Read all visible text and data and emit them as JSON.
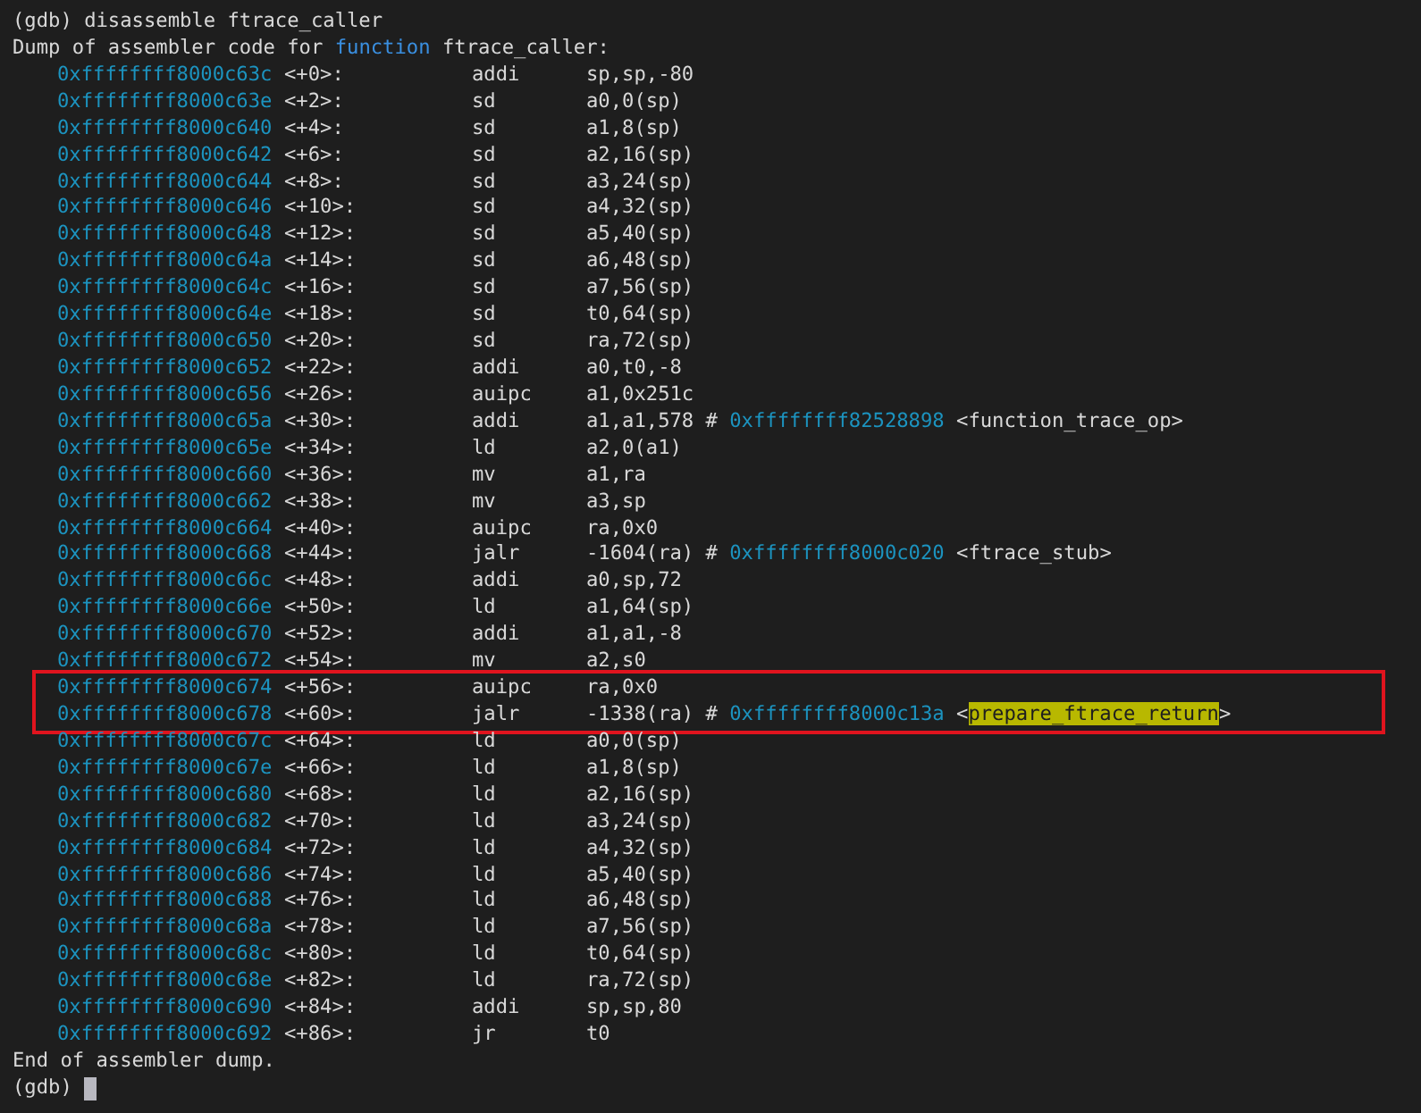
{
  "terminal": {
    "command_line": {
      "prompt": "(gdb)",
      "command": "disassemble ftrace_caller"
    },
    "header": [
      {
        "text": "Dump of assembler code for ",
        "kind": "plain"
      },
      {
        "text": "function",
        "kind": "keyword"
      },
      {
        "text": " ftrace_caller:",
        "kind": "plain"
      }
    ],
    "rows": [
      {
        "address": "0xffffffff8000c63c",
        "offset": "<+0>:",
        "mnemonic": "addi",
        "operands": "sp,sp,-80",
        "boxed": false
      },
      {
        "address": "0xffffffff8000c63e",
        "offset": "<+2>:",
        "mnemonic": "sd",
        "operands": "a0,0(sp)",
        "boxed": false
      },
      {
        "address": "0xffffffff8000c640",
        "offset": "<+4>:",
        "mnemonic": "sd",
        "operands": "a1,8(sp)",
        "boxed": false
      },
      {
        "address": "0xffffffff8000c642",
        "offset": "<+6>:",
        "mnemonic": "sd",
        "operands": "a2,16(sp)",
        "boxed": false
      },
      {
        "address": "0xffffffff8000c644",
        "offset": "<+8>:",
        "mnemonic": "sd",
        "operands": "a3,24(sp)",
        "boxed": false
      },
      {
        "address": "0xffffffff8000c646",
        "offset": "<+10>:",
        "mnemonic": "sd",
        "operands": "a4,32(sp)",
        "boxed": false
      },
      {
        "address": "0xffffffff8000c648",
        "offset": "<+12>:",
        "mnemonic": "sd",
        "operands": "a5,40(sp)",
        "boxed": false
      },
      {
        "address": "0xffffffff8000c64a",
        "offset": "<+14>:",
        "mnemonic": "sd",
        "operands": "a6,48(sp)",
        "boxed": false
      },
      {
        "address": "0xffffffff8000c64c",
        "offset": "<+16>:",
        "mnemonic": "sd",
        "operands": "a7,56(sp)",
        "boxed": false
      },
      {
        "address": "0xffffffff8000c64e",
        "offset": "<+18>:",
        "mnemonic": "sd",
        "operands": "t0,64(sp)",
        "boxed": false
      },
      {
        "address": "0xffffffff8000c650",
        "offset": "<+20>:",
        "mnemonic": "sd",
        "operands": "ra,72(sp)",
        "boxed": false
      },
      {
        "address": "0xffffffff8000c652",
        "offset": "<+22>:",
        "mnemonic": "addi",
        "operands": "a0,t0,-8",
        "boxed": false
      },
      {
        "address": "0xffffffff8000c656",
        "offset": "<+26>:",
        "mnemonic": "auipc",
        "operands": "a1,0x251c",
        "boxed": false
      },
      {
        "address": "0xffffffff8000c65a",
        "offset": "<+30>:",
        "mnemonic": "addi",
        "operands": "a1,a1,578",
        "boxed": false,
        "comment": {
          "hash": "#",
          "target": "0xffffffff82528898",
          "open": "<",
          "symbol": "function_trace_op",
          "close": ">",
          "highlighted": false
        }
      },
      {
        "address": "0xffffffff8000c65e",
        "offset": "<+34>:",
        "mnemonic": "ld",
        "operands": "a2,0(a1)",
        "boxed": false
      },
      {
        "address": "0xffffffff8000c660",
        "offset": "<+36>:",
        "mnemonic": "mv",
        "operands": "a1,ra",
        "boxed": false
      },
      {
        "address": "0xffffffff8000c662",
        "offset": "<+38>:",
        "mnemonic": "mv",
        "operands": "a3,sp",
        "boxed": false
      },
      {
        "address": "0xffffffff8000c664",
        "offset": "<+40>:",
        "mnemonic": "auipc",
        "operands": "ra,0x0",
        "boxed": false
      },
      {
        "address": "0xffffffff8000c668",
        "offset": "<+44>:",
        "mnemonic": "jalr",
        "operands": "-1604(ra)",
        "boxed": false,
        "comment": {
          "hash": "#",
          "target": "0xffffffff8000c020",
          "open": "<",
          "symbol": "ftrace_stub",
          "close": ">",
          "highlighted": false
        }
      },
      {
        "address": "0xffffffff8000c66c",
        "offset": "<+48>:",
        "mnemonic": "addi",
        "operands": "a0,sp,72",
        "boxed": false
      },
      {
        "address": "0xffffffff8000c66e",
        "offset": "<+50>:",
        "mnemonic": "ld",
        "operands": "a1,64(sp)",
        "boxed": false
      },
      {
        "address": "0xffffffff8000c670",
        "offset": "<+52>:",
        "mnemonic": "addi",
        "operands": "a1,a1,-8",
        "boxed": false
      },
      {
        "address": "0xffffffff8000c672",
        "offset": "<+54>:",
        "mnemonic": "mv",
        "operands": "a2,s0",
        "boxed": false
      },
      {
        "address": "0xffffffff8000c674",
        "offset": "<+56>:",
        "mnemonic": "auipc",
        "operands": "ra,0x0",
        "boxed": true
      },
      {
        "address": "0xffffffff8000c678",
        "offset": "<+60>:",
        "mnemonic": "jalr",
        "operands": "-1338(ra)",
        "boxed": true,
        "comment": {
          "hash": "#",
          "target": "0xffffffff8000c13a",
          "open": "<",
          "symbol": "prepare_ftrace_return",
          "close": ">",
          "highlighted": true
        }
      },
      {
        "address": "0xffffffff8000c67c",
        "offset": "<+64>:",
        "mnemonic": "ld",
        "operands": "a0,0(sp)",
        "boxed": false
      },
      {
        "address": "0xffffffff8000c67e",
        "offset": "<+66>:",
        "mnemonic": "ld",
        "operands": "a1,8(sp)",
        "boxed": false
      },
      {
        "address": "0xffffffff8000c680",
        "offset": "<+68>:",
        "mnemonic": "ld",
        "operands": "a2,16(sp)",
        "boxed": false
      },
      {
        "address": "0xffffffff8000c682",
        "offset": "<+70>:",
        "mnemonic": "ld",
        "operands": "a3,24(sp)",
        "boxed": false
      },
      {
        "address": "0xffffffff8000c684",
        "offset": "<+72>:",
        "mnemonic": "ld",
        "operands": "a4,32(sp)",
        "boxed": false
      },
      {
        "address": "0xffffffff8000c686",
        "offset": "<+74>:",
        "mnemonic": "ld",
        "operands": "a5,40(sp)",
        "boxed": false
      },
      {
        "address": "0xffffffff8000c688",
        "offset": "<+76>:",
        "mnemonic": "ld",
        "operands": "a6,48(sp)",
        "boxed": false
      },
      {
        "address": "0xffffffff8000c68a",
        "offset": "<+78>:",
        "mnemonic": "ld",
        "operands": "a7,56(sp)",
        "boxed": false
      },
      {
        "address": "0xffffffff8000c68c",
        "offset": "<+80>:",
        "mnemonic": "ld",
        "operands": "t0,64(sp)",
        "boxed": false
      },
      {
        "address": "0xffffffff8000c68e",
        "offset": "<+82>:",
        "mnemonic": "ld",
        "operands": "ra,72(sp)",
        "boxed": false
      },
      {
        "address": "0xffffffff8000c690",
        "offset": "<+84>:",
        "mnemonic": "addi",
        "operands": "sp,sp,80",
        "boxed": false
      },
      {
        "address": "0xffffffff8000c692",
        "offset": "<+86>:",
        "mnemonic": "jr",
        "operands": "t0",
        "boxed": false
      }
    ],
    "footer": "End of assembler dump.",
    "prompt_line": {
      "prompt": "(gdb)",
      "cursor": true
    }
  }
}
